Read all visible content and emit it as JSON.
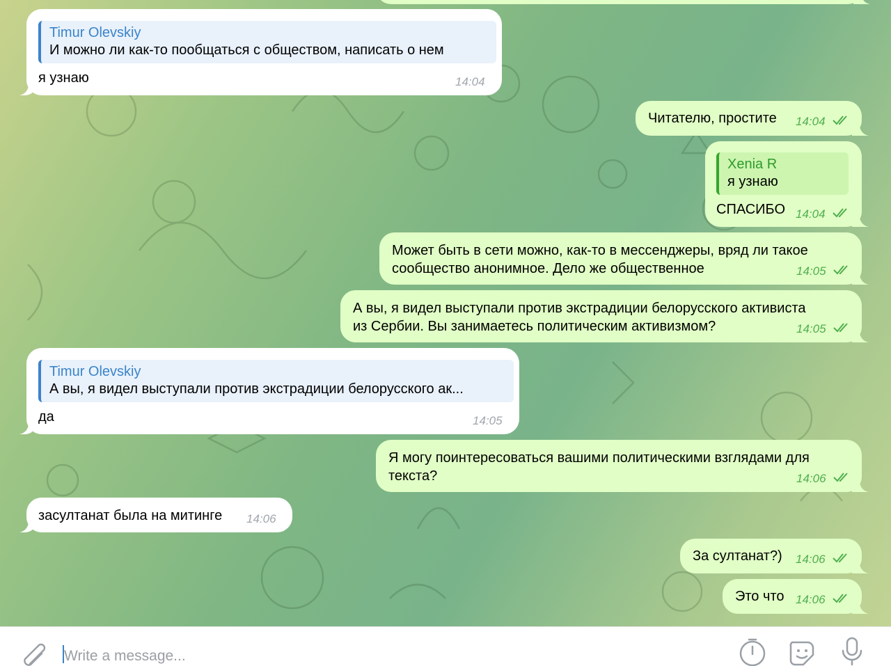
{
  "messages": [
    {
      "direction": "in",
      "reply": {
        "name": "Timur Olevskiy",
        "text": "И можно ли как-то пообщаться с обществом, написать о нем"
      },
      "text": "я узнаю",
      "time": "14:04"
    },
    {
      "direction": "out",
      "text": "Читателю, простите",
      "time": "14:04",
      "status": "read"
    },
    {
      "direction": "out",
      "reply": {
        "name": "Xenia R",
        "text": "я узнаю"
      },
      "text": "СПАСИБО",
      "time": "14:04",
      "status": "read"
    },
    {
      "direction": "out",
      "text": "Может быть в сети можно, как-то в мессенджеры, вряд ли такое",
      "text2": "сообщество анонимное. Дело же общественное",
      "time": "14:05",
      "status": "read"
    },
    {
      "direction": "out",
      "text": "А вы, я видел выступали против экстрадиции белорусского активиста",
      "text2": "из Сербии. Вы занимаетесь политическим активизмом?",
      "time": "14:05",
      "status": "read"
    },
    {
      "direction": "in",
      "reply": {
        "name": "Timur Olevskiy",
        "text": "А вы, я видел выступали против экстрадиции белорусского ак..."
      },
      "text": "да",
      "time": "14:05"
    },
    {
      "direction": "out",
      "text": "Я могу поинтересоваться вашими политическими взглядами для",
      "text2": "текста?",
      "time": "14:06",
      "status": "read"
    },
    {
      "direction": "in",
      "text": "засултанат была на митинге",
      "time": "14:06"
    },
    {
      "direction": "out",
      "text": "За султанат?)",
      "time": "14:06",
      "status": "read"
    },
    {
      "direction": "out",
      "text": "Это что",
      "time": "14:06",
      "status": "read"
    }
  ],
  "input": {
    "placeholder": "Write a message..."
  },
  "icons": {
    "attach": "paperclip-icon",
    "timer": "timer-icon",
    "sticker": "sticker-icon",
    "voice": "microphone-icon"
  },
  "colors": {
    "incoming": "#ffffff",
    "outgoing": "#e1fec6",
    "reply_in_accent": "#3d82c9",
    "reply_out_accent": "#37a62d",
    "time_out": "#4fae4e"
  }
}
